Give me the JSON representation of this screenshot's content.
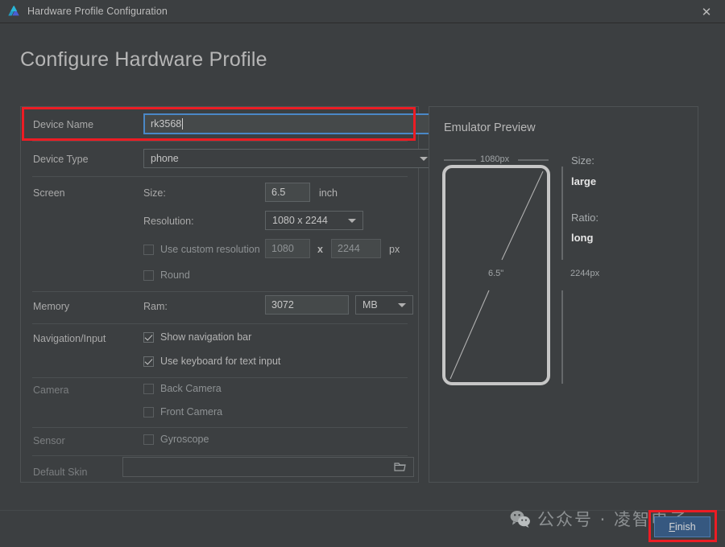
{
  "window": {
    "title": "Hardware Profile Configuration",
    "logo_icon": "android-studio-logo",
    "close_icon": "close-icon",
    "heading": "Configure Hardware Profile",
    "bg_color": "#3c3f41",
    "accent_color": "#365880",
    "highlight_color": "#ec1c24"
  },
  "form": {
    "device_name": {
      "label": "Device Name",
      "value": "rk3568"
    },
    "device_type": {
      "label": "Device Type",
      "value": "phone"
    },
    "screen": {
      "label": "Screen",
      "size_label": "Size:",
      "size_value": "6.5",
      "size_unit": "inch",
      "resolution_label": "Resolution:",
      "resolution_value": "1080 x 2244",
      "custom_resolution_label": "Use custom resolution",
      "custom_width": "1080",
      "custom_x": "x",
      "custom_height": "2244",
      "custom_unit": "px",
      "round_label": "Round"
    },
    "memory": {
      "label": "Memory",
      "ram_label": "Ram:",
      "ram_value": "3072",
      "ram_unit": "MB"
    },
    "navigation": {
      "label": "Navigation/Input",
      "show_nav_bar": "Show navigation bar",
      "use_keyboard": "Use keyboard for text input"
    },
    "camera": {
      "label": "Camera",
      "back": "Back Camera",
      "front": "Front Camera"
    },
    "sensor": {
      "label": "Sensor",
      "gyroscope": "Gyroscope"
    },
    "skin": {
      "label": "Default Skin",
      "value": "",
      "browse_icon": "folder-icon"
    }
  },
  "preview": {
    "title": "Emulator Preview",
    "width_label": "1080px",
    "height_label": "2244px",
    "diagonal_label": "6.5\"",
    "size_key": "Size:",
    "size_value": "large",
    "ratio_key": "Ratio:",
    "ratio_value": "long"
  },
  "footer": {
    "finish_label_prefix": "",
    "finish_accel": "F",
    "finish_label_suffix": "inish",
    "finish_label": "Finish",
    "watermark_icon": "wechat-icon",
    "watermark_text": "公众号 · 凌智电子"
  }
}
